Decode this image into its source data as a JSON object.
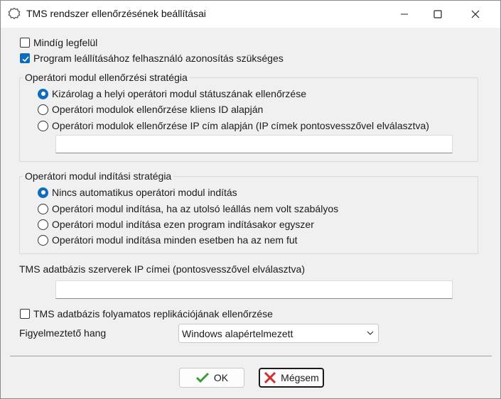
{
  "window": {
    "title": "TMS rendszer ellenőrzésének beállításai"
  },
  "options": {
    "always_on_top": {
      "label": "Mindíg legfelül",
      "checked": false
    },
    "require_user_auth": {
      "label": "Program leállításához felhasználó azonosítás szükséges",
      "checked": true
    }
  },
  "check_strategy": {
    "legend": "Operátori modul ellenőrzési stratégia",
    "options": [
      {
        "label": "Kizárolag a helyi operátori modul státuszának ellenőrzése",
        "selected": true
      },
      {
        "label": "Operátori modulok ellenőrzése kliens ID alapján",
        "selected": false
      },
      {
        "label": "Operátori modulok ellenőrzése IP cím alapján  (IP címek pontosvesszővel elválasztva)",
        "selected": false
      }
    ],
    "ip_value": ""
  },
  "start_strategy": {
    "legend": "Operátori modul indítási stratégia",
    "options": [
      {
        "label": "Nincs automatikus operátori modul indítás",
        "selected": true
      },
      {
        "label": "Operátori modul indítása, ha az utolsó leállás nem volt szabályos",
        "selected": false
      },
      {
        "label": "Operátori modul indítása ezen program indításakor egyszer",
        "selected": false
      },
      {
        "label": "Operátori modul indítása minden esetben ha az nem fut",
        "selected": false
      }
    ]
  },
  "db_servers": {
    "label": "TMS adatbázis szerverek IP címei (pontosvesszővel elválasztva)",
    "value": ""
  },
  "replication_check": {
    "label": "TMS adatbázis folyamatos replikációjának ellenőrzése",
    "checked": false
  },
  "warning_sound": {
    "label": "Figyelmeztető hang",
    "selected": "Windows alapértelmezett"
  },
  "buttons": {
    "ok": "OK",
    "cancel": "Mégsem"
  },
  "colors": {
    "accent": "#0f6cbd",
    "ok_icon": "#3a9b3a",
    "cancel_icon": "#d03030"
  }
}
